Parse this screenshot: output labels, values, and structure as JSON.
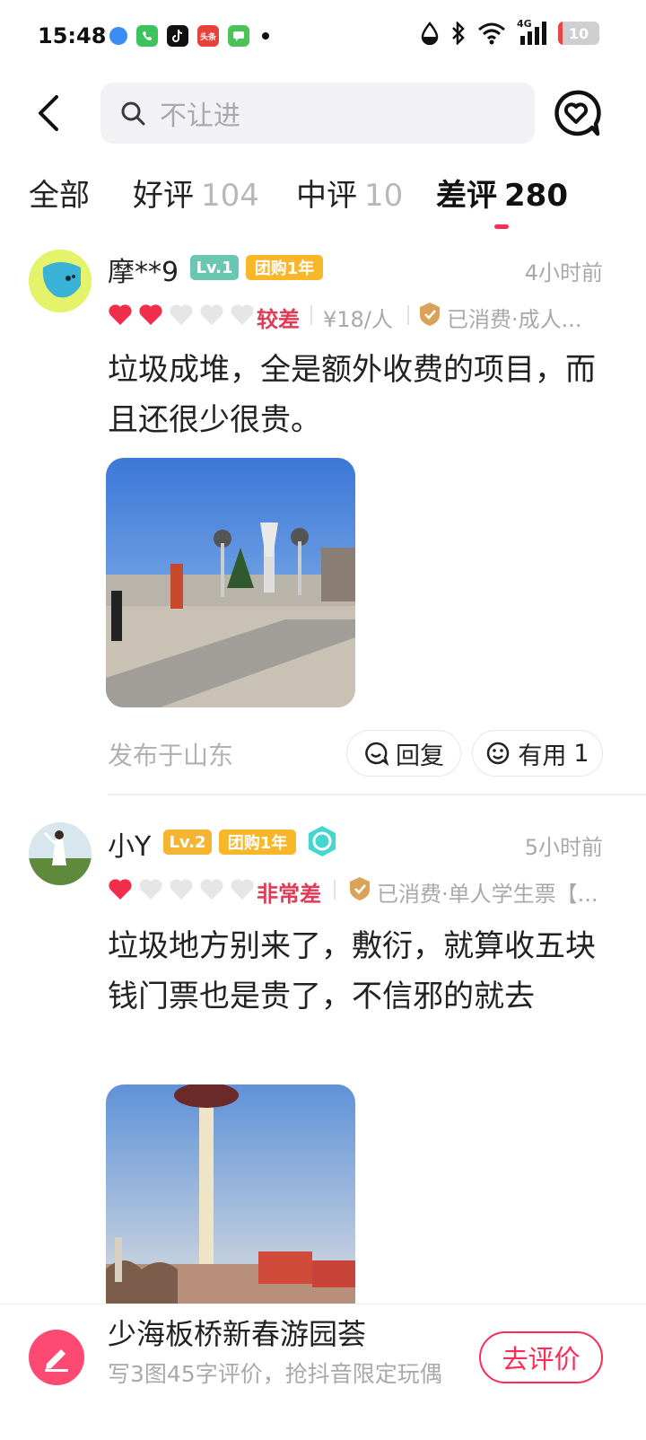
{
  "status": {
    "time": "15:48",
    "network": "4G",
    "battery": "10",
    "battery_fraction": 0.1,
    "toutiao_label": "头条"
  },
  "search": {
    "placeholder": "不让进"
  },
  "tabs": [
    {
      "label": "全部",
      "count": ""
    },
    {
      "label": "好评",
      "count": "104"
    },
    {
      "label": "中评",
      "count": "10"
    },
    {
      "label": "差评",
      "count": "280",
      "active": true
    }
  ],
  "reviews": [
    {
      "name": "摩**9",
      "level": "Lv.1",
      "group_badge": "团购1年",
      "time": "4小时前",
      "hearts_filled": 2,
      "hearts_total": 5,
      "rating_word": "较差",
      "price": "¥18/人",
      "consumed": "已消费·成人...",
      "text": "垃圾成堆，全是额外收费的项目，而且还很少很贵。",
      "location": "发布于山东",
      "reply_label": "回复",
      "useful_label": "有用",
      "useful_count": "1"
    },
    {
      "name": "小Y",
      "level": "Lv.2",
      "group_badge": "团购1年",
      "time": "5小时前",
      "hearts_filled": 1,
      "hearts_total": 5,
      "rating_word": "非常差",
      "consumed": "已消费·单人学生票【...",
      "text": "垃圾地方别来了，敷衍，就算收五块钱门票也是贵了，不信邪的就去"
    }
  ],
  "bottom": {
    "title": "少海板桥新春游园荟",
    "subtitle": "写3图45字评价，抢抖音限定玩偶",
    "button": "去评价"
  },
  "colors": {
    "accent": "#fe2c55",
    "heart_red": "#f02d4a",
    "heart_grey": "#e6e6e8",
    "rating_red": "#e23a56",
    "level1": "#6bc6b2",
    "level2": "#f5b533",
    "group_badge": "#f7b728"
  }
}
